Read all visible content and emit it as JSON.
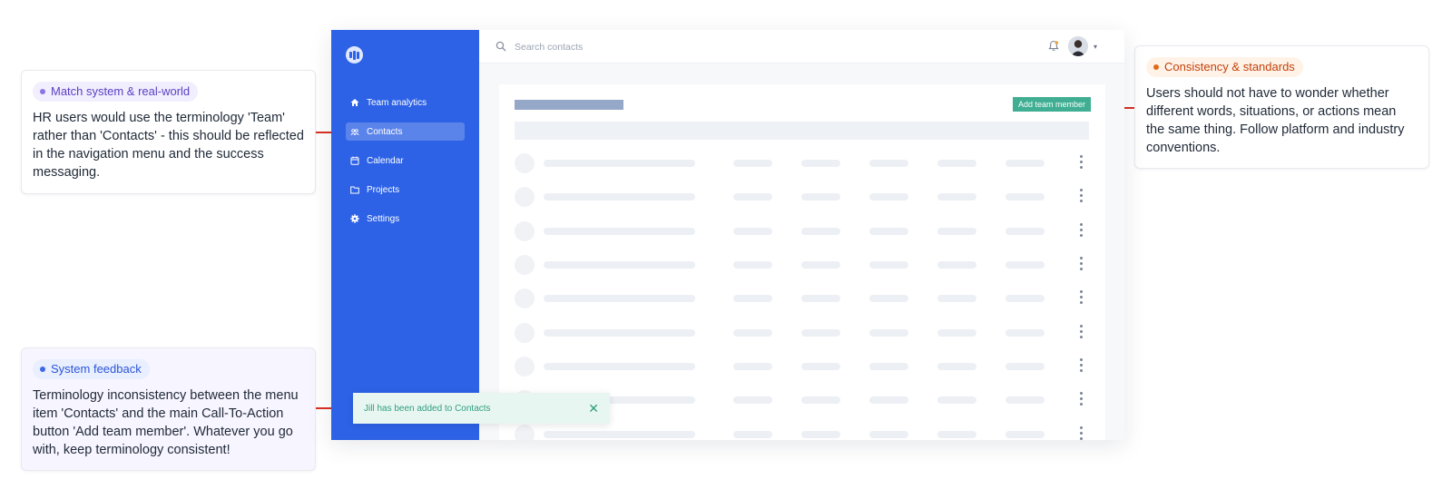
{
  "annotations": {
    "match": {
      "tag": "Match system & real-world",
      "text": "HR users would use the terminology 'Team' rather than 'Contacts' - this should be reflected in the navigation menu and the success messaging."
    },
    "feedback": {
      "tag": "System feedback",
      "text": "Terminology inconsistency between the menu item 'Contacts' and the main Call-To-Action button 'Add team member'. Whatever you go with, keep terminology consistent!"
    },
    "consistency": {
      "tag": "Consistency & standards",
      "text": "Users should not have to wonder whether different words, situations, or actions mean the same thing. Follow platform and industry conventions."
    }
  },
  "app": {
    "sidebar": {
      "items": [
        {
          "label": "Team analytics",
          "icon": "home-icon"
        },
        {
          "label": "Contacts",
          "icon": "users-icon",
          "active": true
        },
        {
          "label": "Calendar",
          "icon": "calendar-icon"
        },
        {
          "label": "Projects",
          "icon": "folder-icon"
        },
        {
          "label": "Settings",
          "icon": "gear-icon"
        }
      ]
    },
    "search": {
      "placeholder": "Search contacts"
    },
    "main": {
      "add_button": "Add team member"
    },
    "toast": {
      "message": "Jill has been added to Contacts"
    }
  },
  "colors": {
    "sidebar": "#2d62e6",
    "accent_button": "#3fae92",
    "connector": "#d93025"
  }
}
